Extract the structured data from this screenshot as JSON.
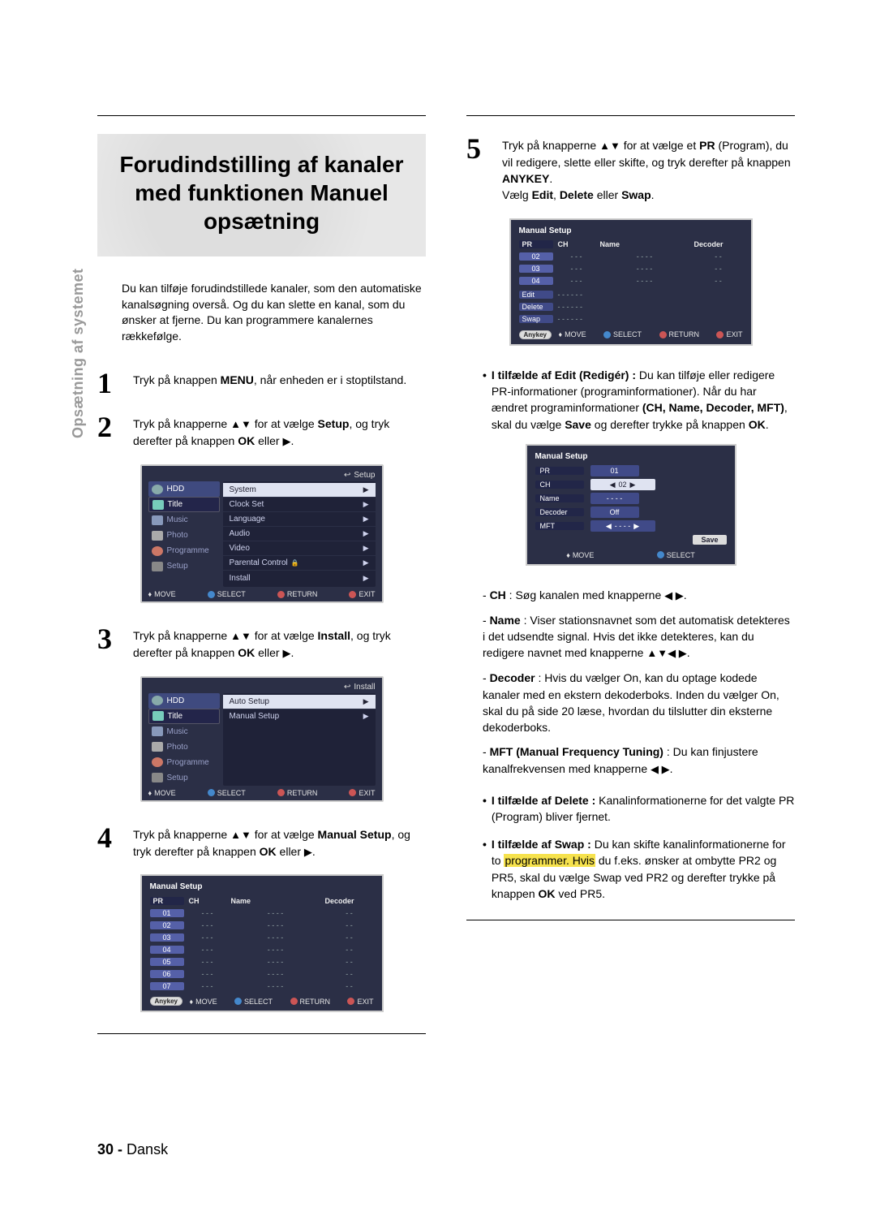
{
  "sidebar_label": "Opsætning af systemet",
  "page_number": "30 -",
  "page_lang": "Dansk",
  "heading": "Forudindstilling af kanaler med funktionen Manuel opsætning",
  "intro": "Du kan tilføje forudindstillede kanaler, som den automatiske kanalsøgning overså. Og du kan slette en kanal, som du ønsker at fjerne. Du kan programmere kanalernes rækkefølge.",
  "glyphs": {
    "up_down": "▲▼",
    "right": "▶",
    "left": "◀",
    "left_right": "◀ ▶",
    "all4": "▲▼◀ ▶",
    "move4": "♦",
    "back": "↩"
  },
  "steps": {
    "s1_pre": "Tryk på knappen ",
    "s1_menu": "MENU",
    "s1_post": ", når enheden er i stoptilstand.",
    "s2_pre": "Tryk på knapperne ",
    "s2_mid": " for at vælge ",
    "s2_setup": "Setup",
    "s2_post1": ", og tryk derefter på knappen ",
    "s2_ok": "OK",
    "s2_post2": " eller ",
    "s3_mid": " for at vælge ",
    "s3_install": "Install",
    "s3_post1": ", og tryk derefter på knappen ",
    "s4_mid": " for at vælge ",
    "s4_manual": "Manual Setup",
    "s4_post1": ", og tryk derefter på knappen ",
    "s5_mid": " for at vælge et ",
    "s5_pr": "PR",
    "s5_line2": " (Program), du vil redigere, slette eller skifte, og tryk derefter på knappen ",
    "s5_anykey": "ANYKEY",
    "s5_line3_pre": "Vælg ",
    "s5_edit": "Edit",
    "s5_delete": "Delete",
    "s5_swap": "Swap",
    "s5_or": " eller ",
    "s5_comma": ", "
  },
  "osd_common": {
    "move": "MOVE",
    "select": "SELECT",
    "return": "RETURN",
    "exit": "EXIT",
    "anykey": "Anykey"
  },
  "osd1": {
    "breadcrumb": "Setup",
    "side": [
      "HDD",
      "Title",
      "Music",
      "Photo",
      "Programme",
      "Setup"
    ],
    "main": [
      {
        "label": "System",
        "sel": true
      },
      {
        "label": "Clock Set"
      },
      {
        "label": "Language"
      },
      {
        "label": "Audio"
      },
      {
        "label": "Video"
      },
      {
        "label": "Parental Control",
        "lock": true
      },
      {
        "label": "Install"
      }
    ]
  },
  "osd2": {
    "breadcrumb": "Install",
    "main": [
      {
        "label": "Auto Setup",
        "sel": true
      },
      {
        "label": "Manual Setup"
      }
    ]
  },
  "osd3": {
    "title": "Manual Setup",
    "head": [
      "PR",
      "CH",
      "Name",
      "Decoder"
    ],
    "rows": [
      [
        "01",
        "- - -",
        "- - - -",
        "- -"
      ],
      [
        "02",
        "- - -",
        "- - - -",
        "- -"
      ],
      [
        "03",
        "- - -",
        "- - - -",
        "- -"
      ],
      [
        "04",
        "- - -",
        "- - - -",
        "- -"
      ],
      [
        "05",
        "- - -",
        "- - - -",
        "- -"
      ],
      [
        "06",
        "- - -",
        "- - - -",
        "- -"
      ],
      [
        "07",
        "- - -",
        "- - - -",
        "- -"
      ]
    ]
  },
  "osd4": {
    "title": "Manual Setup",
    "head": [
      "PR",
      "CH",
      "Name",
      "Decoder"
    ],
    "rows": [
      [
        "02",
        "- - -",
        "- - - -",
        "- -"
      ],
      [
        "03",
        "- - -",
        "- - - -",
        "- -"
      ],
      [
        "04",
        "- - -",
        "- - - -",
        "- -"
      ]
    ],
    "context": [
      [
        "Edit",
        "- - - -",
        "- -"
      ],
      [
        "Delete",
        "- - - -",
        "- -"
      ],
      [
        "Swap",
        "- - - -",
        "- -"
      ]
    ]
  },
  "osd5": {
    "title": "Manual Setup",
    "fields": [
      {
        "lab": "PR",
        "val": "01"
      },
      {
        "lab": "CH",
        "val": "02",
        "sel": true,
        "arrows": true
      },
      {
        "lab": "Name",
        "val": "- - - -"
      },
      {
        "lab": "Decoder",
        "val": "Off"
      },
      {
        "lab": "MFT",
        "val": "- - - -",
        "arrows": true
      }
    ],
    "save": "Save"
  },
  "edit_block": {
    "lead": "I tilfælde af Edit (Redigér) :",
    "body": " Du kan tilføje eller redigere PR-informationer (programinformationer). Når du har ændret programinformationer ",
    "bold2": "(CH, Name, Decoder, MFT)",
    "body2": ", skal du vælge ",
    "save": "Save",
    "body3": " og derefter trykke på knappen ",
    "ok": "OK"
  },
  "defs": {
    "ch_lab": "CH",
    "ch_txt": " : Søg kanalen med knapperne ",
    "name_lab": "Name",
    "name_txt": " : Viser stationsnavnet som det automatisk detekteres i det udsendte signal. Hvis det ikke detekteres, kan du redigere navnet med knapperne ",
    "dec_lab": "Decoder",
    "dec_txt": " : Hvis du vælger On, kan du optage kodede kanaler med en ekstern dekoderboks. Inden du vælger On, skal du på side 20 læse, hvordan du tilslutter din eksterne dekoderboks.",
    "mft_lab": "MFT (Manual Frequency Tuning)",
    "mft_txt": " : Du kan finjustere kanalfrekvensen med knapperne "
  },
  "delete_block": {
    "lead": "I tilfælde af Delete :",
    "body": " Kanalinformationerne for det valgte PR (Program) bliver fjernet."
  },
  "swap_block": {
    "lead": "I tilfælde af Swap :",
    "body_a": " Du kan skifte kanalinformationerne for to ",
    "hl": "programmer. Hvis",
    "body_b": " du f.eks. ønsker at ombytte PR2 og PR5, skal du vælge Swap ved PR2 og derefter trykke på knappen ",
    "ok": "OK",
    "body_c": " ved PR5."
  }
}
